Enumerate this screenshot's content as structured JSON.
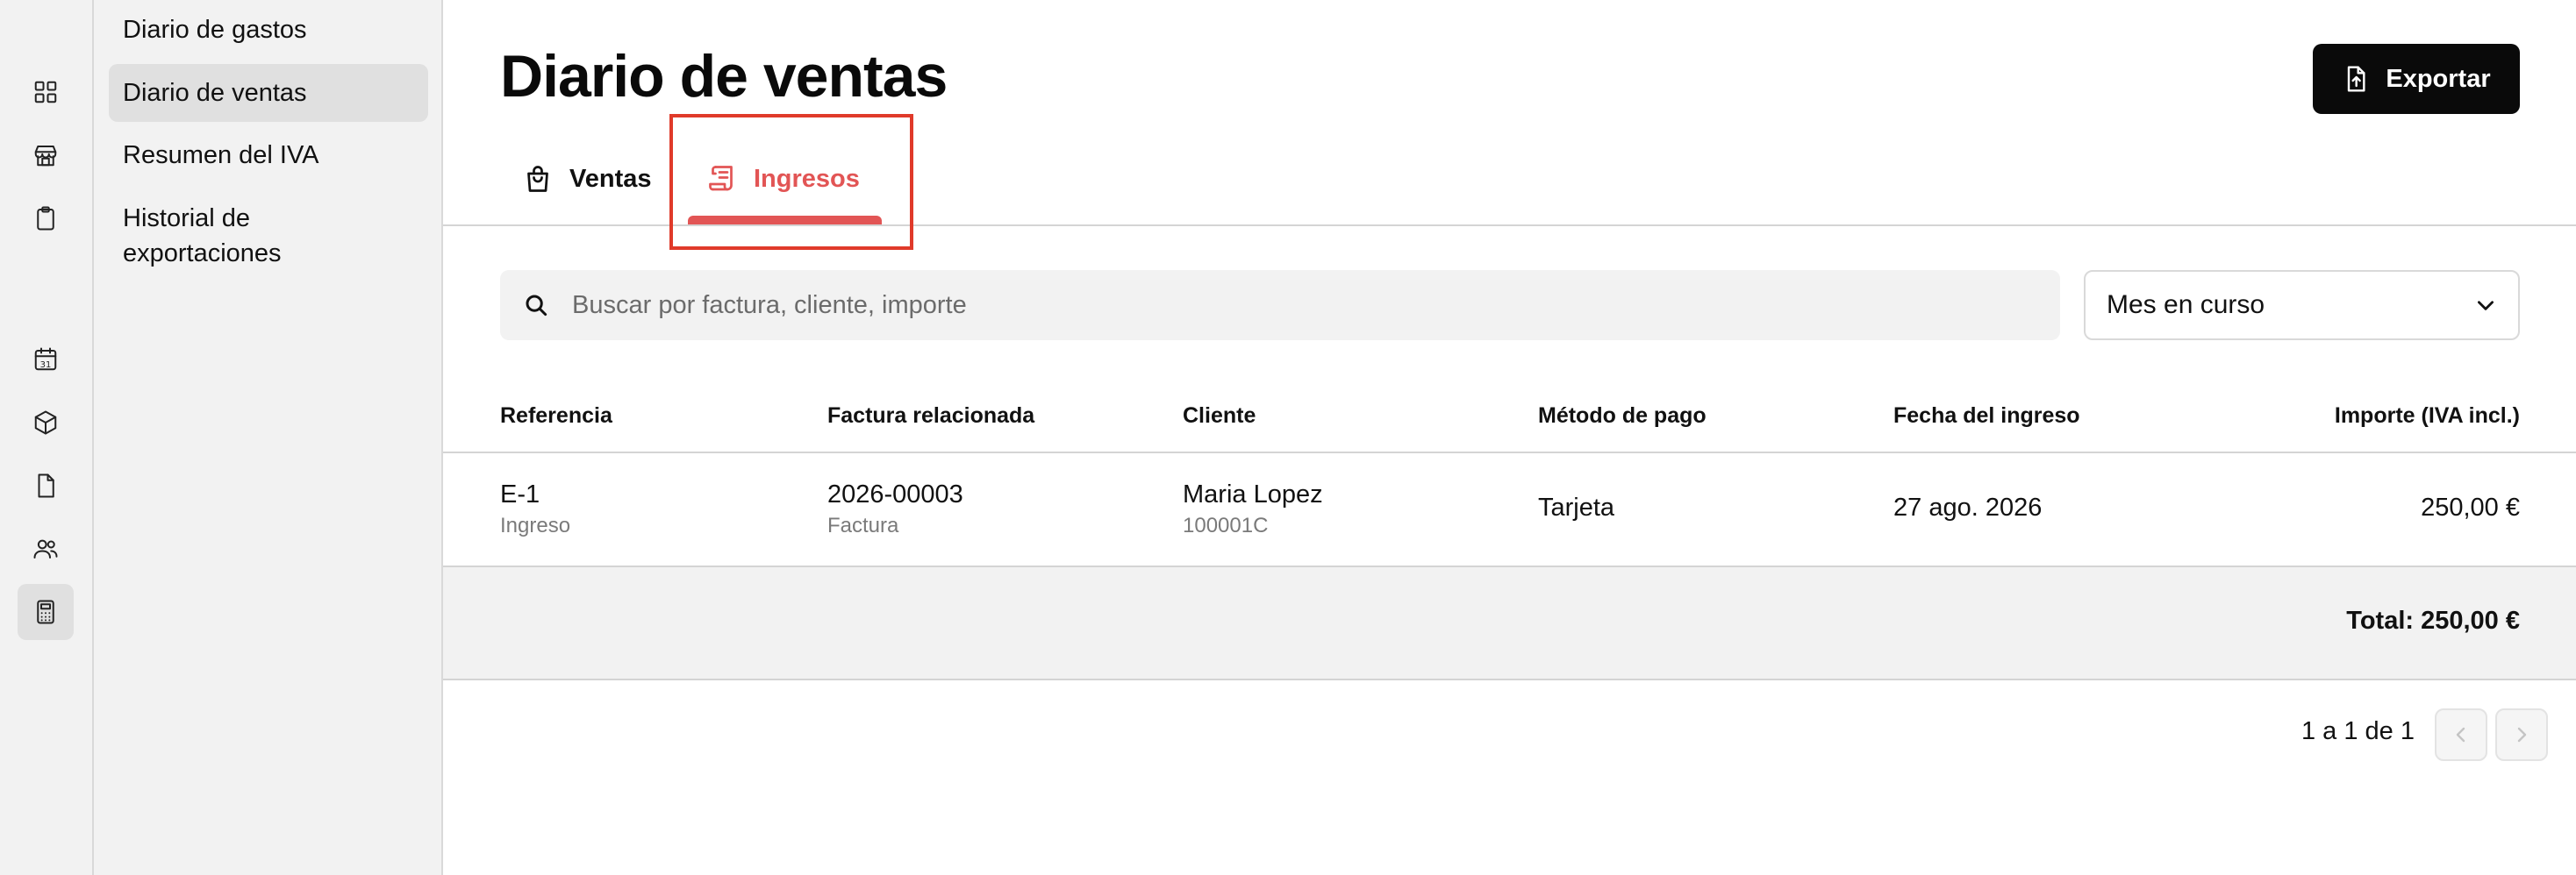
{
  "rail": {
    "icons": [
      "dashboard-icon",
      "store-icon",
      "clipboard-icon",
      "calendar-icon",
      "box-icon",
      "document-icon",
      "users-icon",
      "calculator-icon"
    ],
    "calendar_day": "31",
    "active": "calculator-icon"
  },
  "subnav": {
    "items": [
      {
        "label": "Diario de gastos"
      },
      {
        "label": "Diario de ventas"
      },
      {
        "label": "Resumen del IVA"
      },
      {
        "label": "Historial de exportaciones"
      }
    ],
    "active_index": 1
  },
  "header": {
    "title": "Diario de ventas",
    "export_label": "Exportar"
  },
  "tabs": [
    {
      "label": "Ventas",
      "icon": "shopping-bag-icon"
    },
    {
      "label": "Ingresos",
      "icon": "receipt-icon"
    }
  ],
  "active_tab": "Ingresos",
  "accent_color": "#e25555",
  "highlight_color": "#e03a2a",
  "search": {
    "placeholder": "Buscar por factura, cliente, importe",
    "value": ""
  },
  "filter": {
    "selected": "Mes en curso"
  },
  "table": {
    "columns": [
      "Referencia",
      "Factura relacionada",
      "Cliente",
      "Método de pago",
      "Fecha del ingreso",
      "Importe (IVA incl.)"
    ],
    "rows": [
      {
        "reference": "E-1",
        "reference_type": "Ingreso",
        "invoice": "2026-00003",
        "invoice_type": "Factura",
        "client": "Maria Lopez",
        "client_id": "100001C",
        "payment_method": "Tarjeta",
        "date": "27 ago. 2026",
        "amount": "250,00 €"
      }
    ],
    "total": "Total: 250,00 €"
  },
  "pagination": {
    "text": "1 a 1 de 1"
  }
}
